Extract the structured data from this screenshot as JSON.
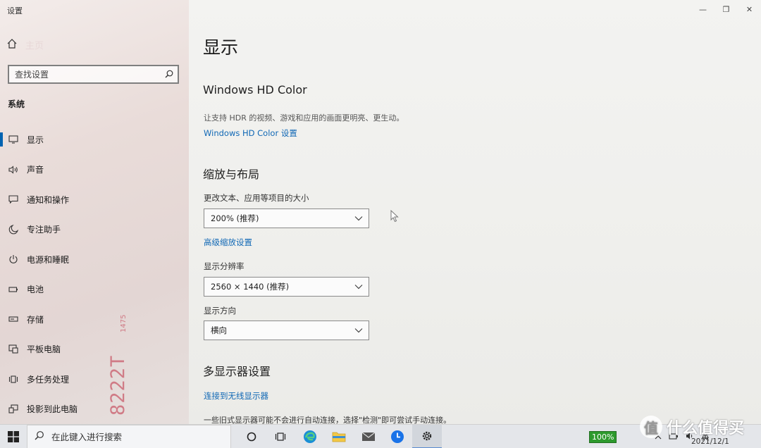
{
  "window": {
    "title": "设置",
    "minimize": "—",
    "maximize": "❐",
    "close": "✕"
  },
  "sidebar": {
    "home_label": "主页",
    "search_placeholder": "查找设置",
    "section": "系统",
    "items": [
      {
        "label": "显示",
        "icon": "monitor-icon"
      },
      {
        "label": "声音",
        "icon": "speaker-icon"
      },
      {
        "label": "通知和操作",
        "icon": "notification-icon"
      },
      {
        "label": "专注助手",
        "icon": "moon-icon"
      },
      {
        "label": "电源和睡眠",
        "icon": "power-icon"
      },
      {
        "label": "电池",
        "icon": "battery-icon"
      },
      {
        "label": "存储",
        "icon": "storage-icon"
      },
      {
        "label": "平板电脑",
        "icon": "tablet-icon"
      },
      {
        "label": "多任务处理",
        "icon": "multitask-icon"
      },
      {
        "label": "投影到此电脑",
        "icon": "project-icon"
      }
    ],
    "stamp_big": "8222T",
    "stamp_small": "1475"
  },
  "main": {
    "title": "显示",
    "hd_color": {
      "heading": "Windows HD Color",
      "description": "让支持 HDR 的视频、游戏和应用的画面更明亮、更生动。",
      "link": "Windows HD Color 设置"
    },
    "scale_layout": {
      "heading": "缩放与布局",
      "scale_label": "更改文本、应用等项目的大小",
      "scale_value": "200% (推荐)",
      "advanced_link": "高级缩放设置",
      "resolution_label": "显示分辨率",
      "resolution_value": "2560 × 1440 (推荐)",
      "orientation_label": "显示方向",
      "orientation_value": "横向"
    },
    "multi_display": {
      "heading": "多显示器设置",
      "link": "连接到无线显示器",
      "description": "一些旧式显示器可能不会进行自动连接，选择\"检测\"即可尝试手动连接。"
    }
  },
  "taskbar": {
    "search_placeholder": "在此键入进行搜索",
    "battery": "100%",
    "ime": "英",
    "date": "2021/12/1",
    "watermark": "什么值得买"
  }
}
